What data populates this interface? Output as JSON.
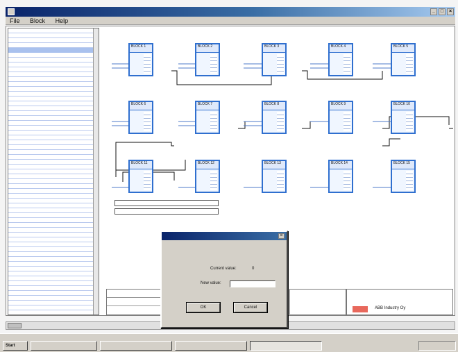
{
  "window": {
    "title": ""
  },
  "menu": [
    "File",
    "Block",
    "Help"
  ],
  "left_panel": {
    "rows": [
      "",
      "",
      "",
      "",
      "",
      "",
      "",
      "",
      "",
      "",
      "",
      "",
      "",
      "",
      "",
      "",
      "",
      "",
      "",
      ""
    ]
  },
  "blocks": [
    {
      "header": "BLOCK 1"
    },
    {
      "header": "BLOCK 2"
    },
    {
      "header": "BLOCK 3"
    },
    {
      "header": "BLOCK 4"
    },
    {
      "header": "BLOCK 5"
    },
    {
      "header": "BLOCK 6"
    },
    {
      "header": "BLOCK 7"
    },
    {
      "header": "BLOCK 8"
    },
    {
      "header": "BLOCK 9"
    },
    {
      "header": "BLOCK 10"
    },
    {
      "header": "BLOCK 11"
    },
    {
      "header": "BLOCK 12"
    },
    {
      "header": "BLOCK 13"
    },
    {
      "header": "BLOCK 14"
    },
    {
      "header": "BLOCK 15"
    }
  ],
  "info_boxes": [
    {
      "label": "",
      "value": ""
    },
    {
      "label": "",
      "value": ""
    }
  ],
  "bottom_right": {
    "brand": "ABB Industry Oy"
  },
  "dialog": {
    "title": "",
    "line1": "",
    "current_label": "Current value:",
    "current_value": "0",
    "new_label": "New value:",
    "new_value": "",
    "ok_label": "OK",
    "cancel_label": "Cancel"
  },
  "taskbar": {
    "start": "Start",
    "tasks": [
      "",
      "",
      "",
      ""
    ],
    "tray_time": ""
  }
}
